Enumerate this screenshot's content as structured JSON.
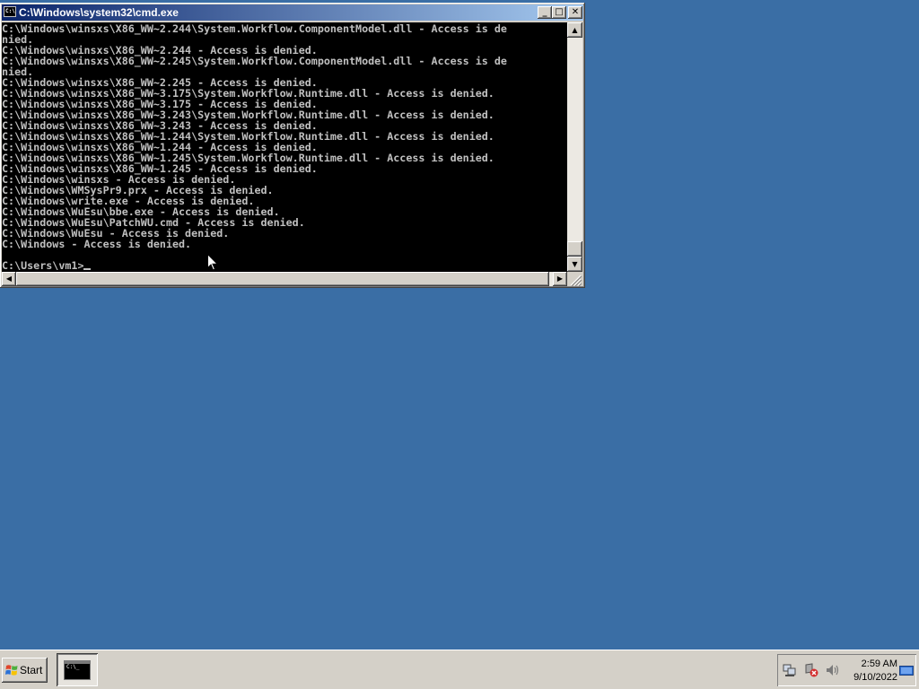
{
  "window": {
    "title": "C:\\Windows\\system32\\cmd.exe",
    "icon_text": "C:\\",
    "minimize_label": "_",
    "maximize_label": "□",
    "close_label": "✕"
  },
  "console": {
    "lines": [
      "C:\\Windows\\winsxs\\X86_WW~2.244\\System.Workflow.ComponentModel.dll - Access is de",
      "nied.",
      "C:\\Windows\\winsxs\\X86_WW~2.244 - Access is denied.",
      "C:\\Windows\\winsxs\\X86_WW~2.245\\System.Workflow.ComponentModel.dll - Access is de",
      "nied.",
      "C:\\Windows\\winsxs\\X86_WW~2.245 - Access is denied.",
      "C:\\Windows\\winsxs\\X86_WW~3.175\\System.Workflow.Runtime.dll - Access is denied.",
      "C:\\Windows\\winsxs\\X86_WW~3.175 - Access is denied.",
      "C:\\Windows\\winsxs\\X86_WW~3.243\\System.Workflow.Runtime.dll - Access is denied.",
      "C:\\Windows\\winsxs\\X86_WW~3.243 - Access is denied.",
      "C:\\Windows\\winsxs\\X86_WW~1.244\\System.Workflow.Runtime.dll - Access is denied.",
      "C:\\Windows\\winsxs\\X86_WW~1.244 - Access is denied.",
      "C:\\Windows\\winsxs\\X86_WW~1.245\\System.Workflow.Runtime.dll - Access is denied.",
      "C:\\Windows\\winsxs\\X86_WW~1.245 - Access is denied.",
      "C:\\Windows\\winsxs - Access is denied.",
      "C:\\Windows\\WMSysPr9.prx - Access is denied.",
      "C:\\Windows\\write.exe - Access is denied.",
      "C:\\Windows\\WuEsu\\bbe.exe - Access is denied.",
      "C:\\Windows\\WuEsu\\PatchWU.cmd - Access is denied.",
      "C:\\Windows\\WuEsu - Access is denied.",
      "C:\\Windows - Access is denied.",
      "",
      "C:\\Users\\vm1>"
    ]
  },
  "taskbar": {
    "start_label": "Start",
    "task_icon_text": "C:\\_",
    "clock_time": "2:59 AM",
    "clock_date": "9/10/2022"
  },
  "colors": {
    "desktop": "#3a6ea5",
    "console_bg": "#000000",
    "console_fg": "#c0c0c0",
    "title_bar": "#0a246a"
  },
  "icons": {
    "window": "cmd-icon",
    "start": "windows-logo-icon",
    "tray": [
      "network-icon",
      "security-alert-icon",
      "volume-icon",
      "show-desktop-icon"
    ]
  }
}
